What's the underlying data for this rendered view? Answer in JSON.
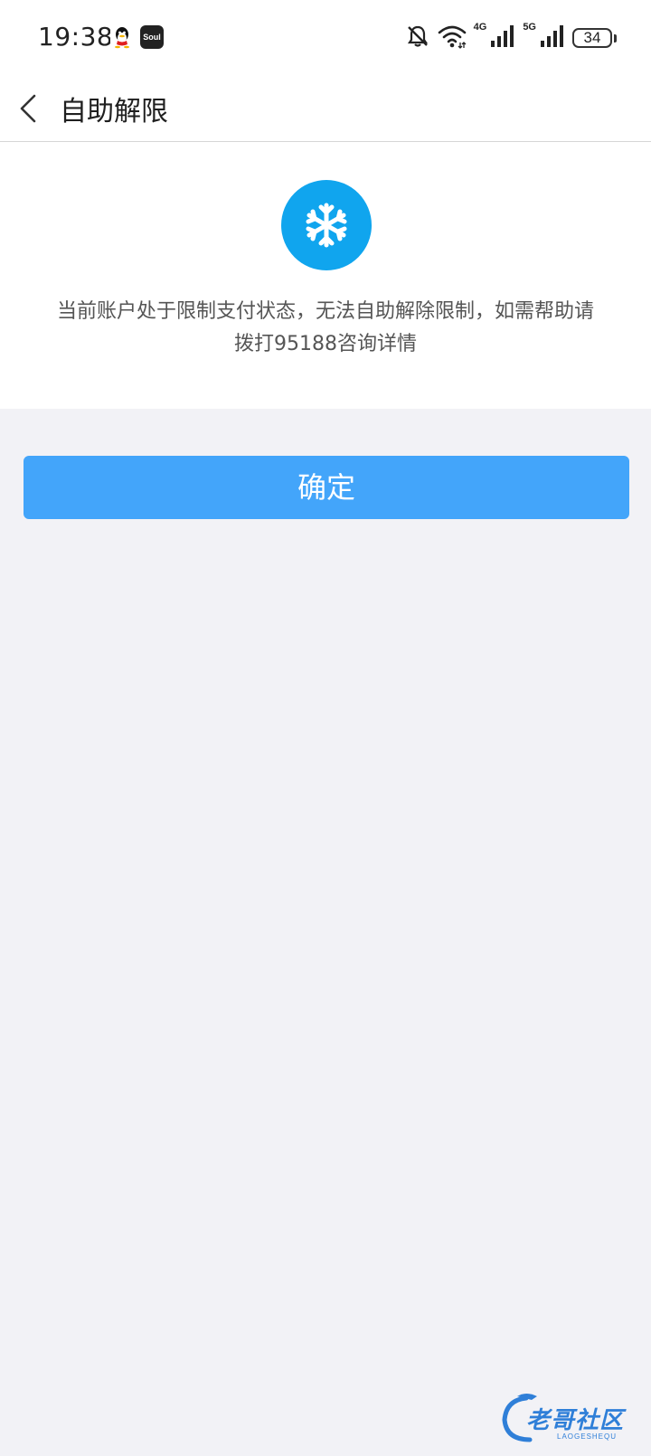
{
  "status_bar": {
    "time": "19:38",
    "network_label_1": "4G",
    "network_label_2": "5G",
    "battery_level": "34"
  },
  "header": {
    "title": "自助解限"
  },
  "content": {
    "message": "当前账户处于限制支付状态，无法自助解除限制，如需帮助请拨打95188咨询详情",
    "icon": "snowflake-icon"
  },
  "actions": {
    "confirm_label": "确定"
  },
  "watermark": {
    "text": "老哥社区",
    "sub": "LAOGESHEQU"
  },
  "colors": {
    "accent": "#43a5fa",
    "icon_bg": "#10a5ee",
    "background": "#f2f2f6"
  }
}
